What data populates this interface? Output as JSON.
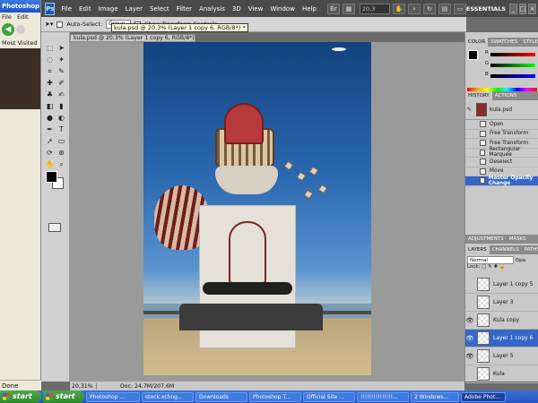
{
  "background_browser": {
    "title": "Photoshop",
    "menu": [
      "File",
      "Edit"
    ],
    "bookmark": "Most Visited",
    "status": "Done"
  },
  "app": {
    "logo": "Ps",
    "menu": [
      "File",
      "Edit",
      "Image",
      "Layer",
      "Select",
      "Filter",
      "Analysis",
      "3D",
      "View",
      "Window",
      "Help"
    ],
    "zoom": "20,3",
    "workspace": "ESSENTIALS"
  },
  "options_bar": {
    "auto_select_label": "Auto-Select:",
    "auto_select_value": "Group",
    "show_transform_label": "Show Transform Controls"
  },
  "document": {
    "tab_title": "kula.psd @ 20,3% (Layer 1 copy 6, RGB/8*) *",
    "tooltip": "kula.psd @ 20,3% (Layer 1 copy 6, RGB/8*) *"
  },
  "color_panel": {
    "tabs": [
      "COLOR",
      "SWATCHES",
      "STYLES"
    ],
    "channels": [
      "R",
      "G",
      "B"
    ]
  },
  "history_panel": {
    "tabs": [
      "HISTORY",
      "ACTIONS"
    ],
    "snapshot": "kula.psd",
    "items": [
      "Open",
      "Free Transform",
      "Free Transform",
      "Rectangular Marquee",
      "Deselect",
      "Move",
      "Master Opacity Change"
    ],
    "active_index": 6
  },
  "adjustments": {
    "tabs": [
      "ADJUSTMENTS",
      "MASKS"
    ]
  },
  "layers_panel": {
    "tabs": [
      "LAYERS",
      "CHANNELS",
      "PATHS"
    ],
    "blend_mode": "Normal",
    "opacity_label": "Opa",
    "lock_label": "Lock:",
    "layers": [
      {
        "name": "Layer 1 copy 5",
        "visible": false
      },
      {
        "name": "Layer 3",
        "visible": false
      },
      {
        "name": "Kula copy",
        "visible": true
      },
      {
        "name": "Layer 1 copy 6",
        "visible": true,
        "active": true
      },
      {
        "name": "Layer 5",
        "visible": true
      },
      {
        "name": "Kula",
        "visible": false
      }
    ]
  },
  "status_bar": {
    "zoom": "20,31%",
    "doc_size": "Doc: 24,7M/207,6M"
  },
  "taskbar": {
    "start_labels": [
      "start",
      "start"
    ],
    "tasks": [
      "Photoshop ...",
      "stock.xchng...",
      "Downloads",
      "Photoshop T...",
      "Official Site ...",
      "!!!!!!!!!!!!!!!...",
      "2 Windows...",
      "Adobe Phot..."
    ],
    "active_task": 7
  }
}
